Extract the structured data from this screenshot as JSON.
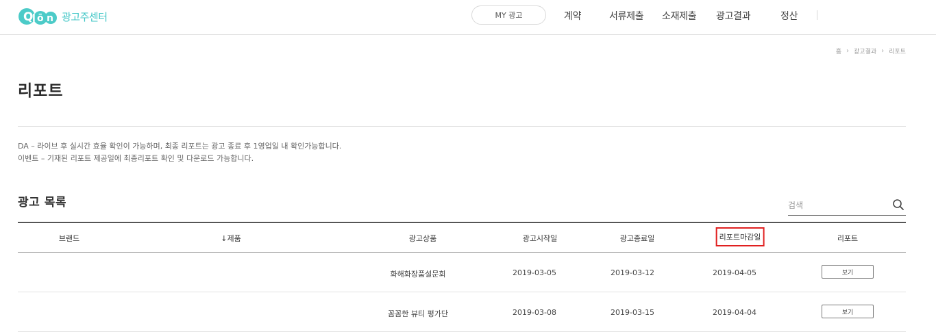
{
  "header": {
    "logo_text": "광고주센터",
    "my_ad_label": "MY 광고",
    "nav": [
      {
        "label": "계약"
      },
      {
        "label": "서류제출"
      },
      {
        "label": "소재제출"
      },
      {
        "label": "광고결과"
      },
      {
        "label": "정산"
      }
    ]
  },
  "breadcrumb": [
    "홈",
    "광고결과",
    "리포트"
  ],
  "page_title": "리포트",
  "notice": [
    "DA – 라이브 후 실시간 효율 확인이 가능하며, 최종 리포트는 광고 종료 후 1영업일 내 확인가능합니다.",
    "이벤트 – 기재된 리포트 제공일에 최종리포트 확인 및 다운로드 가능합니다."
  ],
  "section_title": "광고 목록",
  "search": {
    "placeholder": "검색",
    "value": ""
  },
  "table": {
    "columns": [
      "브랜드",
      "↓제품",
      "광고상품",
      "광고시작일",
      "광고종료일",
      "리포트마감일",
      "리포트"
    ],
    "rows": [
      {
        "brand": "",
        "product": "",
        "ad_product": "화해화장품설문회",
        "start": "2019-03-05",
        "end": "2019-03-12",
        "report_deadline": "2019-04-05",
        "report_button": "보기"
      },
      {
        "brand": "",
        "product": "",
        "ad_product": "꼼꼼한 뷰티 평가단",
        "start": "2019-03-08",
        "end": "2019-03-15",
        "report_deadline": "2019-04-04",
        "report_button": "보기"
      }
    ]
  },
  "colors": {
    "brand": "#3fc6c6",
    "highlight": "#e02020"
  }
}
